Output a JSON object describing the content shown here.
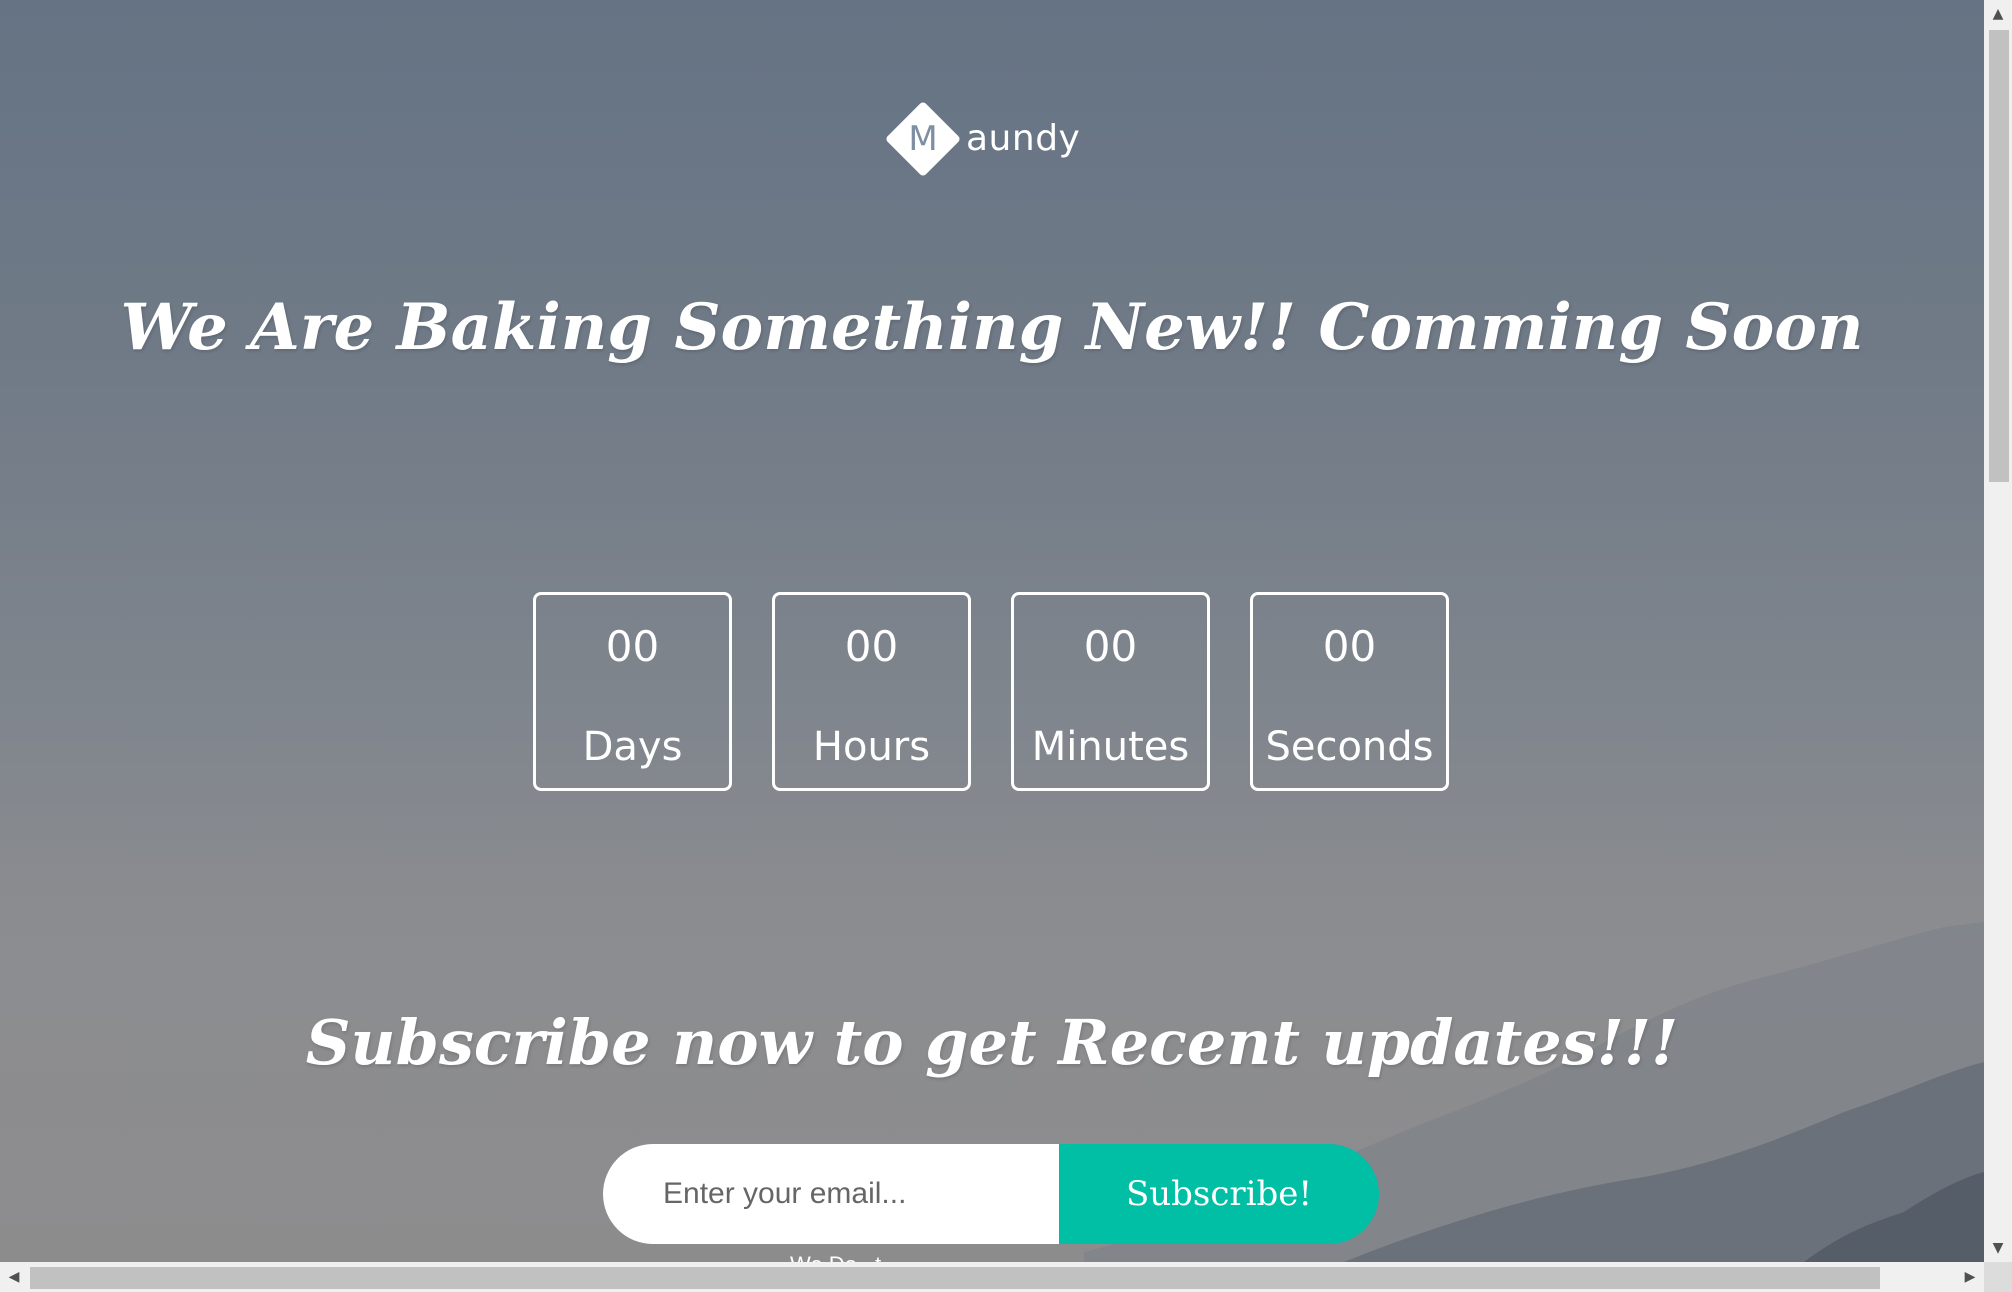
{
  "logo": {
    "letter": "M",
    "text": "aundy"
  },
  "headline": "We Are Baking Something New!! Comming Soon",
  "countdown": [
    {
      "value": "00",
      "unit": "Days"
    },
    {
      "value": "00",
      "unit": "Hours"
    },
    {
      "value": "00",
      "unit": "Minutes"
    },
    {
      "value": "00",
      "unit": "Seconds"
    }
  ],
  "subscribe": {
    "title": "Subscribe now to get Recent updates!!!",
    "email_placeholder": "Enter your email...",
    "email_value": "",
    "button_label": "Subscribe!",
    "below_text": "We Do...t..."
  },
  "colors": {
    "accent": "#00bfa5",
    "background_top": "#657384",
    "background_bottom": "#8d8c8d",
    "text": "#ffffff"
  },
  "scrollbars": {
    "vertical_up_icon": "triangle-up-icon",
    "vertical_down_icon": "triangle-down-icon",
    "horizontal_left_icon": "triangle-left-icon",
    "horizontal_right_icon": "triangle-right-icon"
  }
}
